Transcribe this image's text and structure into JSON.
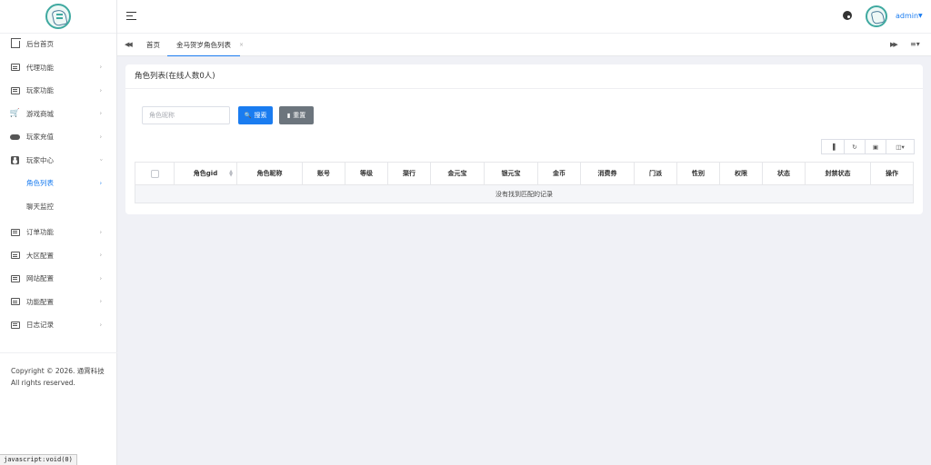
{
  "sidebar": {
    "items": [
      {
        "label": "后台首页",
        "icon": "home-icon"
      },
      {
        "label": "代理功能",
        "icon": "monitor-icon"
      },
      {
        "label": "玩家功能",
        "icon": "monitor-icon"
      },
      {
        "label": "游戏商城",
        "icon": "cart-icon"
      },
      {
        "label": "玩家充值",
        "icon": "gamepad-icon"
      },
      {
        "label": "玩家中心",
        "icon": "user-card-icon"
      }
    ],
    "sub_items": [
      {
        "label": "角色列表",
        "active": true
      },
      {
        "label": "聊天监控",
        "active": false
      }
    ],
    "items_after": [
      {
        "label": "订单功能",
        "icon": "monitor-icon"
      },
      {
        "label": "大区配置",
        "icon": "monitor-icon"
      },
      {
        "label": "网站配置",
        "icon": "monitor-icon"
      },
      {
        "label": "功能配置",
        "icon": "monitor-icon"
      },
      {
        "label": "日志记录",
        "icon": "monitor-icon"
      }
    ],
    "copyright": "Copyright © 2026. 通霄科技 All rights reserved."
  },
  "header": {
    "username": "admin"
  },
  "tabs": [
    {
      "label": "首页"
    },
    {
      "label": "金马贺岁角色列表",
      "active": true
    }
  ],
  "card": {
    "title": "角色列表(在线人数0人)",
    "search": {
      "placeholder": "角色昵称",
      "search_label": "搜索",
      "reset_label": "重置"
    },
    "table": {
      "columns": [
        "角色gid",
        "角色昵称",
        "账号",
        "等级",
        "渠行",
        "金元宝",
        "银元宝",
        "金币",
        "消费券",
        "门派",
        "性别",
        "权限",
        "状态",
        "封禁状态",
        "操作"
      ],
      "empty_text": "没有找到匹配的记录"
    }
  },
  "statusbar": "javascript:void(0)",
  "colors": {
    "accent": "#1a7cf0",
    "reset_button": "#6c757d",
    "background": "#f0f1f6"
  }
}
